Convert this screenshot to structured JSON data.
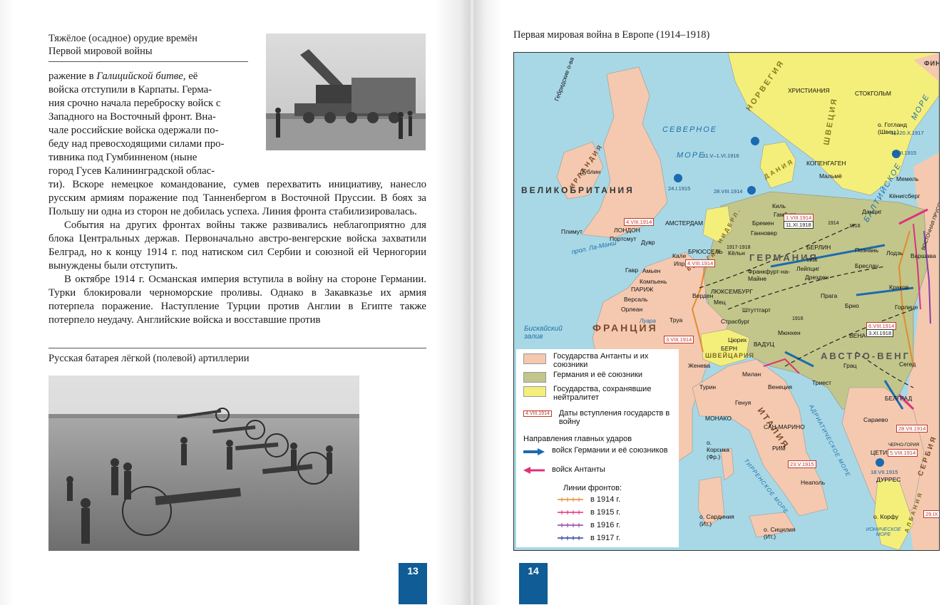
{
  "left_page": {
    "photo1_caption_line1": "Тяжёлое (осадное) орудие времён",
    "photo1_caption_line2": "Первой мировой войны",
    "para1_line1_a": "ражение в ",
    "para1_line1_italic": "Галицийской битве,",
    "para1_line1_b": " её",
    "para1_lines": [
      "войска отступили в Карпаты. Герма-",
      "ния срочно начала переброску войск с",
      "Западного на Восточный фронт. Вна-",
      "чале российские войска одержали по-",
      "беду над превосходящими силами про-",
      "тивника под Гумбинненом (ныне",
      "город Гусев Калининградской облас-"
    ],
    "para1_rest": "ти). Вскоре немецкое командование, сумев перехватить инициативу, на­несло русским армиям поражение под Танненбергом в Восточной Прус­сии. В боях за Польшу ни одна из сторон не добилась успеха. Линия фронта стабилизировалась.",
    "para2": "События на других фронтах войны также развивались неблагоприятно для блока Центральных держав. Первоначально австро-венгерские войска захватили Белград, но к концу 1914 г. под натиском сил Сербии и союзной ей Черногории вынуждены были отступить.",
    "para3": "В октябре 1914 г. Османская империя вступила в войну на стороне Гер­мании. Турки блокировали черноморские проливы. Однако в Закавказье их армия потерпела поражение. Наступление Турции против Англии в Египте также потерпело неудачу. Английские войска и восставшие против",
    "photo2_caption": "Русская батарея лёгкой (полевой) артиллерии",
    "page_number": "13"
  },
  "right_page": {
    "map_title": "Первая мировая война в Европе (1914–1918)",
    "page_number": "14",
    "map": {
      "countries": {
        "uk": "ВЕЛИКОБРИТАНИЯ",
        "france": "ФРАНЦИЯ",
        "austria": "АВСТРО-ВЕНГ",
        "norway": "НОРВЕГИЯ",
        "sweden": "ШВЕЦИЯ",
        "denmark": "ДАНИЯ",
        "ireland": "ИРЛАНДИЯ",
        "netherlands": "НИДЕРЛ.",
        "belgium": "БЕЛЬГИЯ",
        "switzerland": "ШВЕЙЦАРИЯ",
        "germany": "ГЕРМАНИЯ",
        "italy": "ИТАЛИЯ",
        "serbia": "СЕРБИЯ",
        "albania": "АЛБАНИЯ",
        "finland": "ФИН",
        "hebrides": "Гебридские о-ва",
        "east_prussia": "ВОСТОЧНАЯ ПРУССИЯ",
        "montenegro": "ЧЕРНО-ГОРИЯ"
      },
      "seas": {
        "north_sea_1": "СЕВЕРНОЕ",
        "north_sea_2": "МОРЕ",
        "baltic": "БАЛТИЙСКОЕ",
        "baltic_2": "МОРЕ",
        "biscay": "Бискайский залив",
        "channel": "прол. Ла-Манш",
        "adriatic": "АДРИАТИЧЕСКОЕ МОРЕ",
        "tyrrhenian": "ТИРРЕНСКОЕ МОРЕ",
        "ionian": "ИОНИЧЕСКОЕ МОРЕ",
        "loire": "Луара"
      },
      "cities": [
        {
          "name": "Дублин"
        },
        {
          "name": "Плимут"
        },
        {
          "name": "ЛОНДОН"
        },
        {
          "name": "Портсмут"
        },
        {
          "name": "Дувр"
        },
        {
          "name": "АМСТЕРДАМ"
        },
        {
          "name": "Кале"
        },
        {
          "name": "Ипр"
        },
        {
          "name": "БРЮССЕЛЬ"
        },
        {
          "name": "Гавр"
        },
        {
          "name": "Амьен"
        },
        {
          "name": "Компьень"
        },
        {
          "name": "ПАРИЖ"
        },
        {
          "name": "Версаль"
        },
        {
          "name": "Орлеан"
        },
        {
          "name": "Труа"
        },
        {
          "name": "Верден"
        },
        {
          "name": "Мец"
        },
        {
          "name": "ЛЮКСЕМБУРГ"
        },
        {
          "name": "Страсбург"
        },
        {
          "name": "Штуттгарт"
        },
        {
          "name": "Мюнхен"
        },
        {
          "name": "Франкфурт-на-Майне"
        },
        {
          "name": "Кёльн"
        },
        {
          "name": "Ганновер"
        },
        {
          "name": "Бремен"
        },
        {
          "name": "Гамбург"
        },
        {
          "name": "Киль"
        },
        {
          "name": "БЕРЛИН"
        },
        {
          "name": "Лейпциг"
        },
        {
          "name": "Дрезден"
        },
        {
          "name": "Прага"
        },
        {
          "name": "Бреслау"
        },
        {
          "name": "Познань"
        },
        {
          "name": "Лодзь"
        },
        {
          "name": "Варшава"
        },
        {
          "name": "Краков"
        },
        {
          "name": "Горлице"
        },
        {
          "name": "Брно"
        },
        {
          "name": "ВЕНА"
        },
        {
          "name": "Грац"
        },
        {
          "name": "Сегед"
        },
        {
          "name": "Триест"
        },
        {
          "name": "Венеция"
        },
        {
          "name": "Милан"
        },
        {
          "name": "Турин"
        },
        {
          "name": "Генуя"
        },
        {
          "name": "МОНАКО"
        },
        {
          "name": "САН-МАРИНО"
        },
        {
          "name": "РИМ"
        },
        {
          "name": "Неаполь"
        },
        {
          "name": "БЕЛГРАД"
        },
        {
          "name": "Сараево"
        },
        {
          "name": "ЦЕТИНЕ"
        },
        {
          "name": "ДУРРЕС"
        },
        {
          "name": "Данциг"
        },
        {
          "name": "Кёнигсберг"
        },
        {
          "name": "Мемель"
        },
        {
          "name": "СТОКГОЛЬМ"
        },
        {
          "name": "ХРИСТИАНИЯ"
        },
        {
          "name": "КОПЕНГАГЕН"
        },
        {
          "name": "Мальмё"
        },
        {
          "name": "о. Готланд (Швец.)"
        },
        {
          "name": "ВАДУЦ"
        },
        {
          "name": "Цюрих"
        },
        {
          "name": "БЕРН"
        },
        {
          "name": "Женева"
        },
        {
          "name": "о. Корсика (Фр.)"
        },
        {
          "name": "о. Сардиния (Ит.)"
        },
        {
          "name": "о. Сицилия (Ит.)"
        },
        {
          "name": "о. Корфу"
        }
      ],
      "dates": [
        "4.VIII.1914",
        "1.VIII.1914",
        "11.XI.1918",
        "4.VIII.1914",
        "3.VIII.1914",
        "6.VIII.1914",
        "3.XI.1918",
        "28.VII.1914",
        "23.V.1915",
        "29.IX",
        "5.VIII.1914",
        "31.V–1.VI.1916",
        "24.I.1915",
        "28.VIII.1914",
        "2.VII.1915",
        "12–20.X.1917",
        "18.VII.1915"
      ],
      "front_years": [
        "1914",
        "1915",
        "1916",
        "1917-1918",
        "1918"
      ]
    },
    "legend": {
      "entente": "Государства Антанты и их союзники",
      "germany": "Германия и её союзники",
      "neutral": "Государства, сохранявшие нейтралитет",
      "date_sample": "4.VIII.1914",
      "date_label": "Даты вступления государств в войну",
      "directions_title": "Направления главных ударов",
      "german_attacks": "войск Германии и её союзников",
      "entente_attacks": "войск Антанты",
      "fronts_title": "Линии фронтов:",
      "front_1914": "в 1914 г.",
      "front_1915": "в 1915 г.",
      "front_1916": "в 1916 г.",
      "front_1917": "в 1917 г."
    },
    "colors": {
      "entente": "#f4c9b0",
      "germany": "#c2c68a",
      "neutral": "#f4ef7a",
      "sea": "#a8d8e6",
      "page_number_bg": "#0f5c96",
      "german_arrow": "#1c6ab0",
      "entente_arrow": "#e0307a",
      "front_1914": "#e58a2b",
      "front_1915": "#e0307a",
      "front_1916": "#8b3fa8",
      "front_1917": "#2a3e9a"
    }
  }
}
